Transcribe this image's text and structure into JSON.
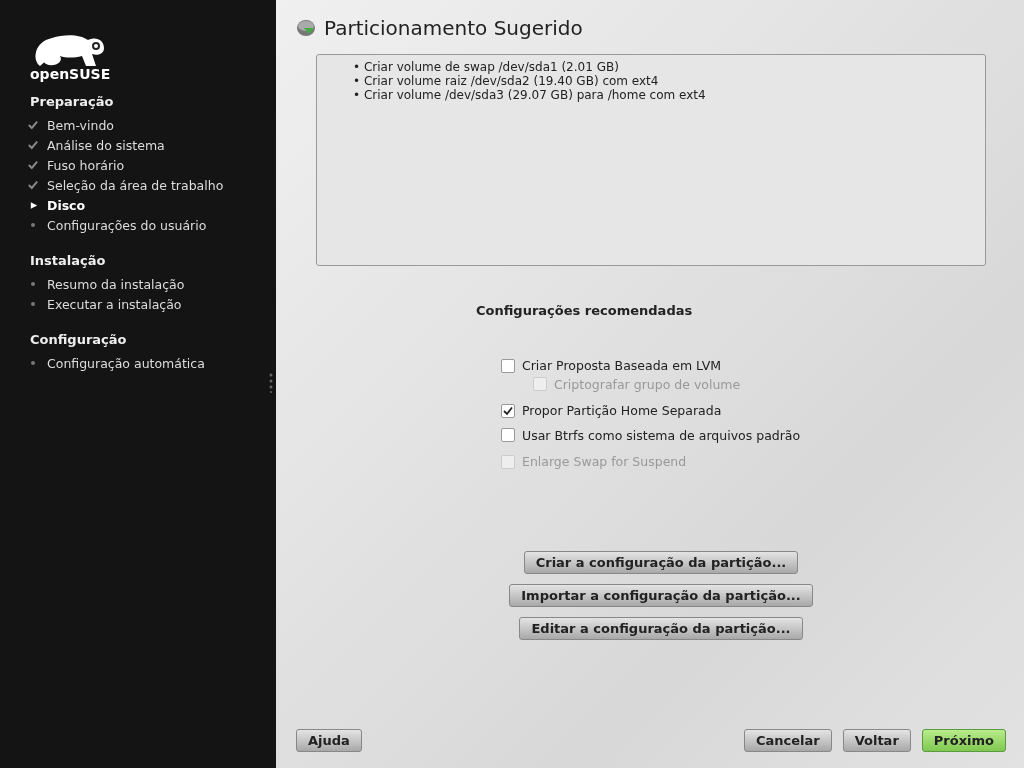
{
  "sidebar": {
    "logo": "openSUSE",
    "sections": [
      {
        "title": "Preparação",
        "steps": [
          {
            "label": "Bem-vindo",
            "kind": "done"
          },
          {
            "label": "Análise do sistema",
            "kind": "done"
          },
          {
            "label": "Fuso horário",
            "kind": "done"
          },
          {
            "label": "Seleção da área de trabalho",
            "kind": "done"
          },
          {
            "label": "Disco",
            "kind": "current"
          },
          {
            "label": "Configurações do usuário",
            "kind": "pending"
          }
        ]
      },
      {
        "title": "Instalação",
        "steps": [
          {
            "label": "Resumo da instalação",
            "kind": "pending"
          },
          {
            "label": "Executar a instalação",
            "kind": "pending"
          }
        ]
      },
      {
        "title": "Configuração",
        "steps": [
          {
            "label": "Configuração automática",
            "kind": "pending"
          }
        ]
      }
    ]
  },
  "page": {
    "title": "Particionamento Sugerido",
    "proposal": [
      "• Criar volume de swap /dev/sda1 (2.01 GB)",
      "• Criar volume raiz /dev/sda2 (19.40 GB) com ext4",
      "• Criar volume /dev/sda3 (29.07 GB) para /home com ext4"
    ],
    "settings_title": "Configurações recomendadas",
    "options": [
      {
        "label": "Criar Proposta Baseada em LVM",
        "checked": false,
        "disabled": false,
        "children": [
          {
            "label": "Criptografar grupo de volume",
            "checked": false,
            "disabled": true
          }
        ]
      },
      {
        "label": "Propor Partição Home Separada",
        "checked": true,
        "disabled": false
      },
      {
        "label": "Usar Btrfs como sistema de arquivos padrão",
        "checked": false,
        "disabled": false
      },
      {
        "label": "Enlarge Swap for Suspend",
        "checked": false,
        "disabled": true
      }
    ],
    "actions": [
      "Criar a configuração da partição...",
      "Importar a configuração da partição...",
      "Editar a configuração da partição..."
    ]
  },
  "footer": {
    "help": "Ajuda",
    "buttons": [
      {
        "label": "Cancelar",
        "kind": "normal"
      },
      {
        "label": "Voltar",
        "kind": "normal"
      },
      {
        "label": "Próximo",
        "kind": "primary"
      }
    ]
  }
}
